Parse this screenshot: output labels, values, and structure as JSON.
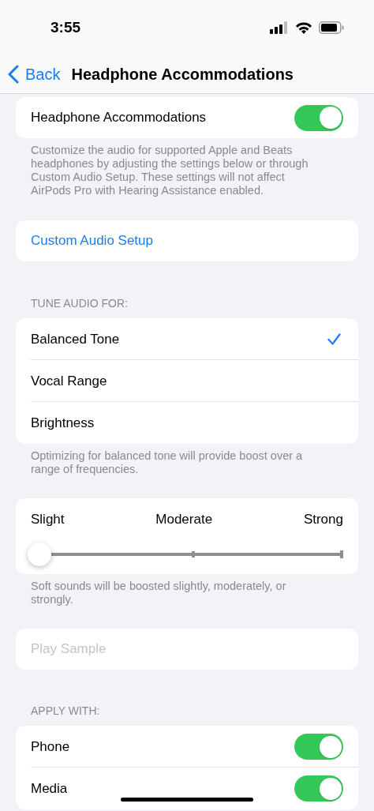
{
  "status_bar": {
    "time": "3:55"
  },
  "nav": {
    "back": "Back",
    "title": "Headphone Accommodations"
  },
  "master": {
    "label": "Headphone Accommodations",
    "on": true,
    "footer": "Customize the audio for supported Apple and Beats headphones by adjusting the settings below or through Custom Audio Setup. These settings will not affect AirPods Pro with Hearing Assistance enabled."
  },
  "custom_audio": {
    "label": "Custom Audio Setup"
  },
  "tune": {
    "header": "TUNE AUDIO FOR:",
    "options": [
      {
        "label": "Balanced Tone",
        "selected": true
      },
      {
        "label": "Vocal Range",
        "selected": false
      },
      {
        "label": "Brightness",
        "selected": false
      }
    ],
    "footer": "Optimizing for balanced tone will provide boost over a range of frequencies."
  },
  "boost": {
    "labels": [
      "Slight",
      "Moderate",
      "Strong"
    ],
    "level": 0,
    "footer": "Soft sounds will be boosted slightly, moderately, or strongly."
  },
  "play_sample": {
    "label": "Play Sample",
    "disabled": true
  },
  "apply": {
    "header": "APPLY WITH:",
    "items": [
      {
        "label": "Phone",
        "on": true
      },
      {
        "label": "Media",
        "on": true
      }
    ]
  }
}
